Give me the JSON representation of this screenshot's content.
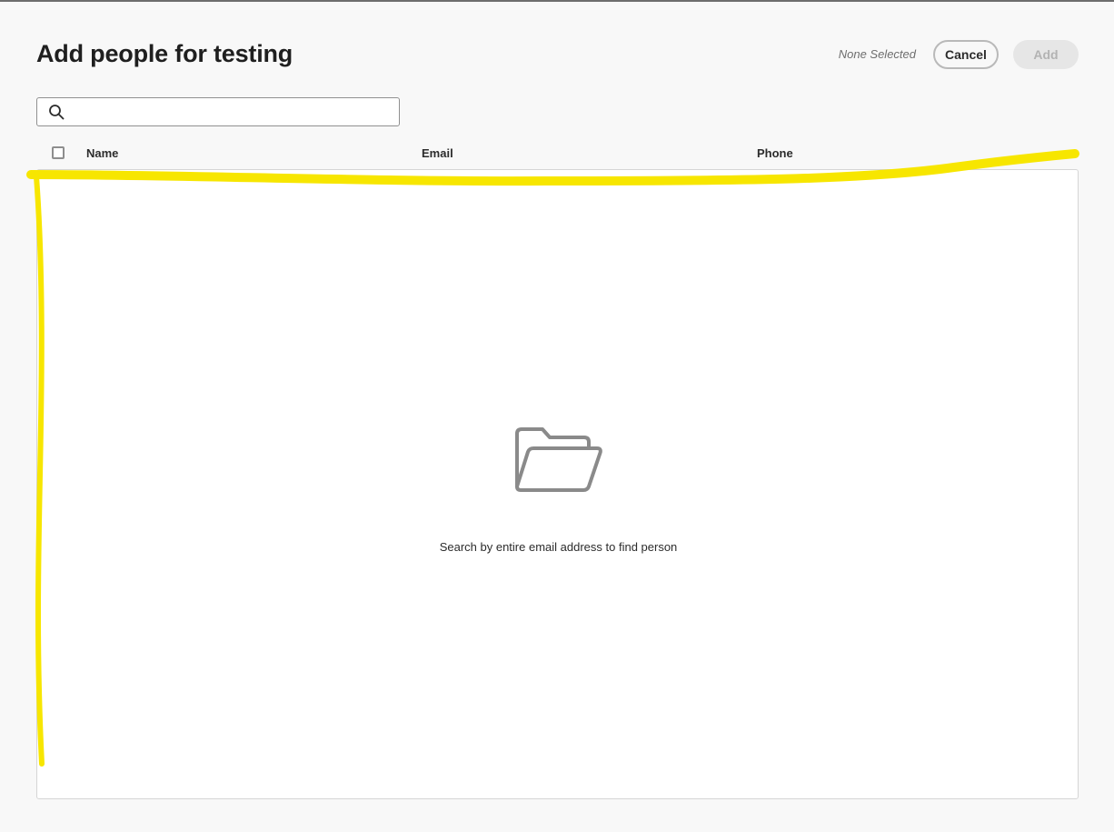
{
  "dialog": {
    "title": "Add people for testing",
    "selection_status": "None Selected",
    "cancel_label": "Cancel",
    "add_label": "Add"
  },
  "search": {
    "placeholder": "",
    "value": "",
    "icon": "search-icon"
  },
  "table": {
    "columns": [
      "Name",
      "Email",
      "Phone"
    ],
    "rows": []
  },
  "empty_state": {
    "icon": "folder-open-icon",
    "message": "Search by entire email address to find person"
  },
  "colors": {
    "annotation_highlight": "#f7e600",
    "background": "#f8f8f8",
    "disabled_button": "#e6e6e6"
  }
}
